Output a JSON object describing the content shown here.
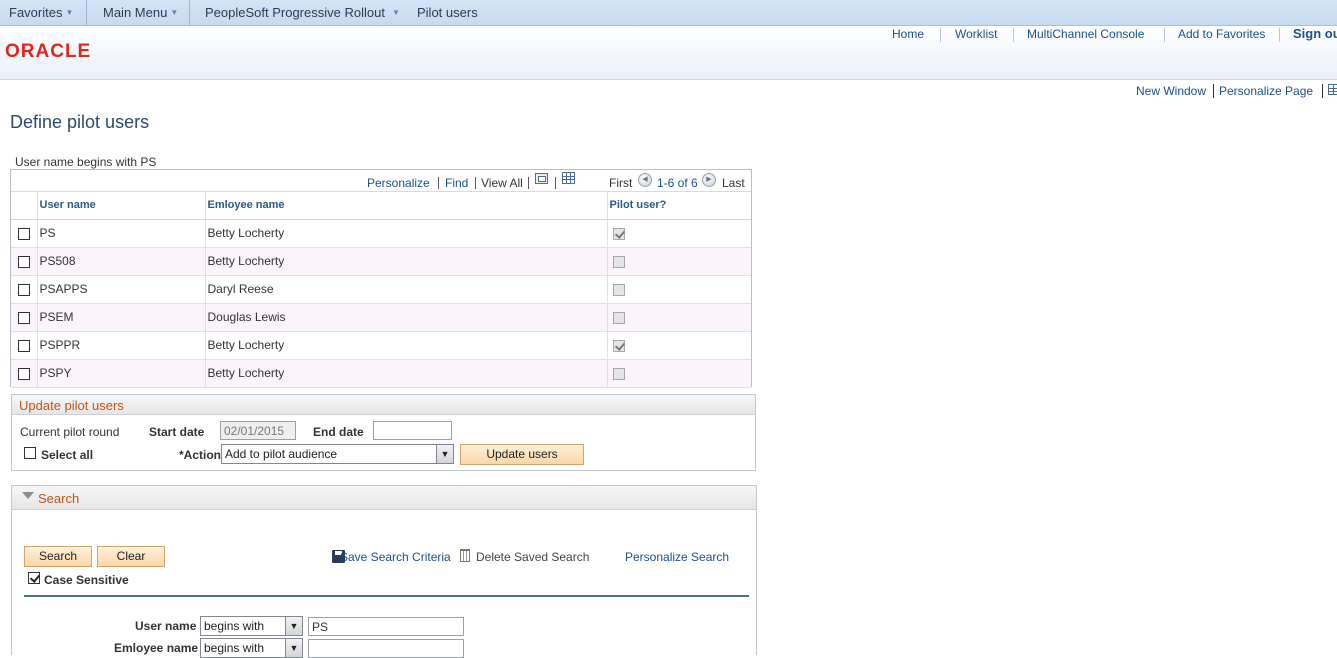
{
  "navbar": {
    "favorites": "Favorites",
    "main_menu": "Main Menu",
    "crumb1": "PeopleSoft Progressive Rollout",
    "crumb2": "Pilot users"
  },
  "header": {
    "logo": "ORACLE",
    "links": [
      "Home",
      "Worklist",
      "MultiChannel Console",
      "Add to Favorites",
      "Sign ou"
    ]
  },
  "utility": {
    "new_window": "New Window",
    "personalize_page": "Personalize Page"
  },
  "page": {
    "title": "Define pilot users",
    "caption": "User name begins with PS"
  },
  "grid": {
    "personalize": "Personalize",
    "find": "Find",
    "view_all": "View All",
    "first": "First",
    "range": "1-6 of 6",
    "last": "Last",
    "columns": [
      "User name",
      "Emloyee name",
      "Pilot user?"
    ],
    "rows": [
      {
        "user": "PS",
        "employee": "Betty Locherty",
        "pilot": true
      },
      {
        "user": "PS508",
        "employee": "Betty Locherty",
        "pilot": false
      },
      {
        "user": "PSAPPS",
        "employee": "Daryl Reese",
        "pilot": false
      },
      {
        "user": "PSEM",
        "employee": "Douglas Lewis",
        "pilot": false
      },
      {
        "user": "PSPPR",
        "employee": "Betty Locherty",
        "pilot": true
      },
      {
        "user": "PSPY",
        "employee": "Betty Locherty",
        "pilot": false
      }
    ]
  },
  "update": {
    "title": "Update pilot users",
    "current_round": "Current pilot round",
    "start_label": "Start date",
    "start_value": "02/01/2015",
    "end_label": "End date",
    "end_value": "",
    "select_all": "Select all",
    "action_label": "*Action",
    "action_value": "Add to pilot audience",
    "update_button": "Update users"
  },
  "search": {
    "title": "Search",
    "search_button": "Search",
    "clear_button": "Clear",
    "case_sensitive": "Case Sensitive",
    "case_sensitive_checked": true,
    "save_criteria": "Save Search Criteria",
    "delete_saved": "Delete Saved Search",
    "personalize_search": "Personalize Search",
    "user_label": "User name",
    "user_op": "begins with",
    "user_value": "PS",
    "emp_label": "Emloyee name",
    "emp_op": "begins with",
    "emp_value": ""
  }
}
